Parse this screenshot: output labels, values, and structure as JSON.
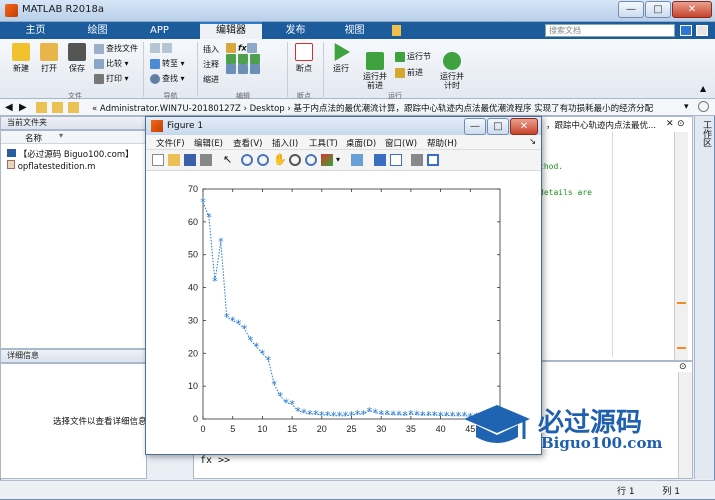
{
  "app": {
    "title": "MATLAB R2018a"
  },
  "window_buttons": {
    "minimize": "—",
    "maximize": "□",
    "close": "✕"
  },
  "tabs": [
    {
      "label": "主页"
    },
    {
      "label": "绘图"
    },
    {
      "label": "APP"
    },
    {
      "label": "编辑器"
    },
    {
      "label": "发布"
    },
    {
      "label": "视图"
    }
  ],
  "search": {
    "placeholder": "搜索文档"
  },
  "toolstrip": {
    "file": {
      "new": "新建",
      "open": "打开",
      "save": "保存",
      "find_files": "查找文件",
      "compare": "比较",
      "print": "打印",
      "group": "文件"
    },
    "navigate": {
      "goto": "转至",
      "find": "查找",
      "group": "导航"
    },
    "edit": {
      "insert": "插入",
      "comment": "注释",
      "indent": "缩进",
      "group": "编辑"
    },
    "breakpoints": {
      "label": "断点",
      "group": "断点"
    },
    "run": {
      "run": "运行",
      "run_advance": "运行并\n前进",
      "run_section": "运行节",
      "advance": "前进",
      "run_time": "运行并\n计时",
      "group": "运行"
    }
  },
  "address": {
    "path": "« Administrator.WIN7U-20180127Z  ›  Desktop  ›  基于内点法的最优潮流计算，跟踪中心轨迹内点法最优潮流程序 实现了有功损耗最小的经济分配"
  },
  "current_folder": {
    "title": "当前文件夹",
    "column": "名称",
    "files": [
      {
        "name": "【必过源码 Biguo100.com】"
      },
      {
        "name": "opflatestedition.m"
      }
    ]
  },
  "details": {
    "title": "详细信息",
    "hint": "选择文件以查看详细信息"
  },
  "editor": {
    "tab_text": "，跟踪中心轨迹内点法最优...",
    "lines": [
      "thod.",
      "details are"
    ]
  },
  "command": {
    "prompt": "fx >>"
  },
  "workspace": {
    "label": "工作区"
  },
  "status": {
    "row_label": "行",
    "row": "1",
    "col_label": "列",
    "col": "1"
  },
  "figure": {
    "title": "Figure 1",
    "menu": [
      "文件(F)",
      "编辑(E)",
      "查看(V)",
      "插入(I)",
      "工具(T)",
      "桌面(D)",
      "窗口(W)",
      "帮助(H)"
    ]
  },
  "watermark": {
    "text": "必过源码",
    "url": "Biguo100.com"
  },
  "chart_data": {
    "type": "line",
    "line_style": "dotted",
    "marker": "*",
    "color": "#1f77d4",
    "xlim": [
      0,
      50
    ],
    "ylim": [
      0,
      70
    ],
    "xticks": [
      0,
      5,
      10,
      15,
      20,
      25,
      30,
      35,
      40,
      45
    ],
    "yticks": [
      0,
      10,
      20,
      30,
      40,
      50,
      60,
      70
    ],
    "x": [
      0,
      1,
      2,
      3,
      4,
      5,
      6,
      7,
      8,
      9,
      10,
      11,
      12,
      13,
      14,
      15,
      16,
      17,
      18,
      19,
      20,
      21,
      22,
      23,
      24,
      25,
      26,
      27,
      28,
      29,
      30,
      31,
      32,
      33,
      34,
      35,
      36,
      37,
      38,
      39,
      40,
      41,
      42,
      43,
      44,
      45,
      46,
      47,
      48
    ],
    "y": [
      66,
      61.5,
      42,
      54,
      31,
      30,
      29,
      27.5,
      24,
      22,
      20,
      18,
      10.5,
      7,
      5,
      4.5,
      2.5,
      2,
      1.5,
      1.5,
      1.2,
      1.2,
      1,
      1,
      1,
      1.2,
      1.5,
      1.5,
      2.5,
      2,
      1.5,
      1.5,
      1.3,
      1.3,
      1.2,
      1.5,
      1.3,
      1.2,
      1.2,
      1.2,
      1.1,
      1.1,
      1,
      1,
      1,
      0.8,
      0.8,
      0.8,
      0.8
    ]
  }
}
